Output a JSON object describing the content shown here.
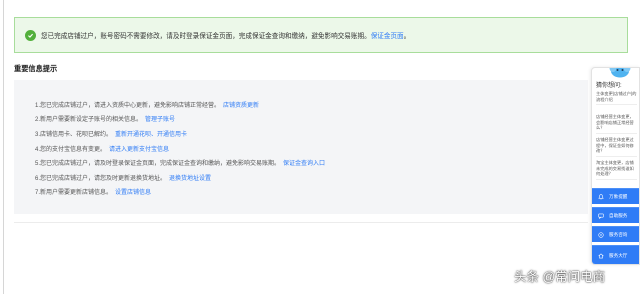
{
  "banner": {
    "text": "您已完成店铺过户，账号密码不需要修改，请及时登录保证金页面，完成保证金查询和缴纳，避免影响交易账期。",
    "link": "保证金页面",
    "end": "。"
  },
  "section": {
    "title": "重要信息提示"
  },
  "info": {
    "rows": [
      {
        "text": "1.您已完成店铺过户，请进入资质中心更新，避免影响店铺正常经营。",
        "link": "店铺资质更新"
      },
      {
        "text": "2.新用户需要新设定子账号的相关信息。",
        "link": "管理子账号"
      },
      {
        "text": "3.店铺信用卡、花呗已解约。",
        "link": "重新开通花呗、开通信用卡"
      },
      {
        "text": "4.您的支付宝信息有变更。",
        "link": "请进入更新支付宝信息"
      },
      {
        "text": "5.您已完成店铺过户，请及时登录保证金页面，完成保证金查询和缴纳，避免影响交易账期。",
        "link": "保证金查询入口"
      },
      {
        "text": "6.您已完成店铺过户，请您及时更新退换货地址。",
        "link": "退换货地址设置"
      },
      {
        "text": "7.新用户需要更新店铺信息。",
        "link": "设置店铺信息"
      }
    ]
  },
  "helper": {
    "title": "猜你想问:",
    "questions": [
      "主体变更(店铺过户)的流程介绍",
      "店铺经营主体变更，会影响店铺正常经营么？",
      "店铺经营主体变更过程中，保证金如何修改？",
      "淘宝主体变更，店铺未完成的交易找谁如何处理？"
    ],
    "buttons": [
      "万象提醒",
      "自助服务",
      "服务咨询",
      "服务大厅"
    ]
  },
  "watermark": "头条 @常问电商"
}
